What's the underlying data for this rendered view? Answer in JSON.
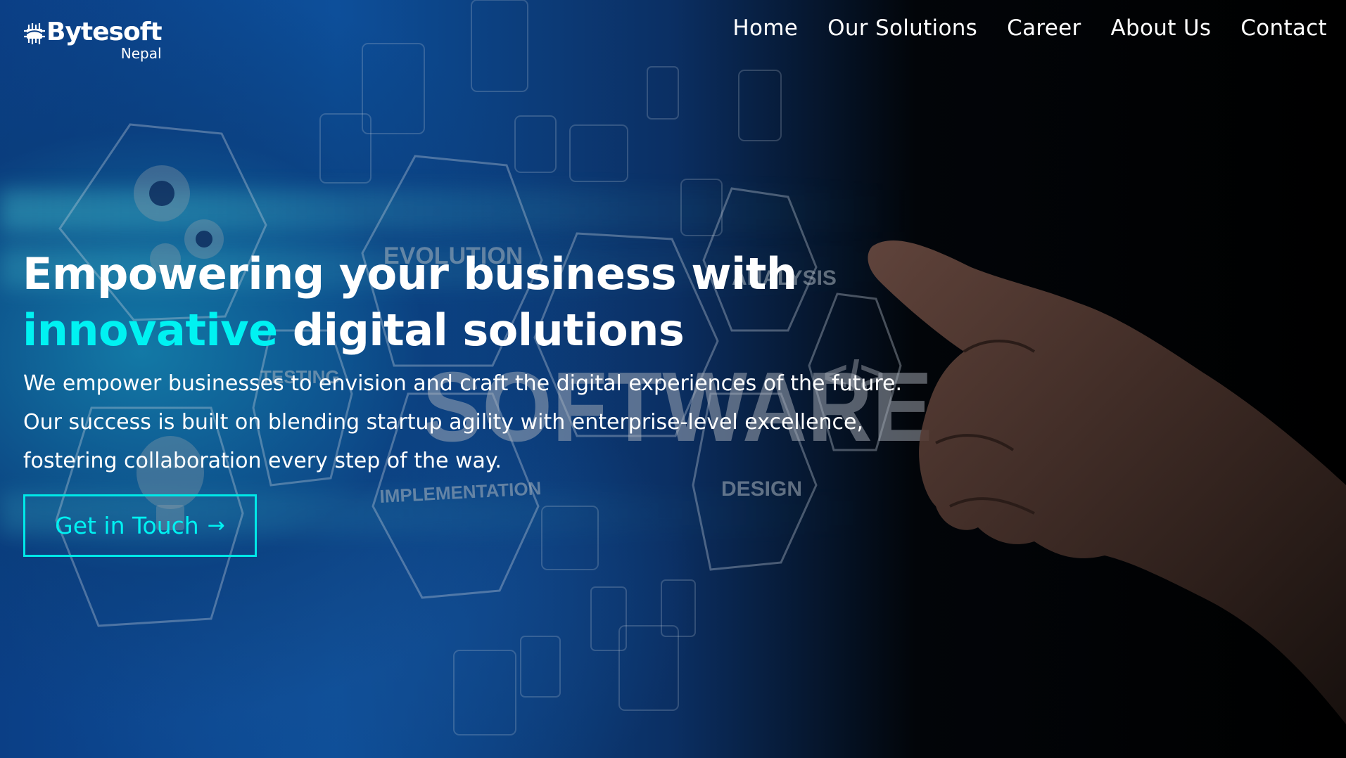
{
  "brand": {
    "name": "Bytesoft",
    "sub": "Nepal",
    "logo_icon": "chip-circuit-icon"
  },
  "nav": {
    "items": [
      {
        "label": "Home"
      },
      {
        "label": "Our Solutions"
      },
      {
        "label": "Career"
      },
      {
        "label": "About Us"
      },
      {
        "label": "Contact"
      }
    ]
  },
  "hero": {
    "headline_line1": "Empowering your business with",
    "headline_accent": "innovative",
    "headline_rest": " digital solutions",
    "description": "We empower businesses to envision and craft the digital experiences of the future. Our success is built on blending startup agility with enterprise-level excellence, fostering collaboration every step of the way.",
    "cta_label": "Get in Touch",
    "cta_icon": "arrow-right-icon",
    "accent_color": "#00f2f2"
  },
  "background": {
    "big_word": "SOFTWARE",
    "hex_labels": [
      "EVOLUTION",
      "ANALYSIS",
      "TESTING",
      "IMPLEMENTATION",
      "DESIGN"
    ]
  }
}
